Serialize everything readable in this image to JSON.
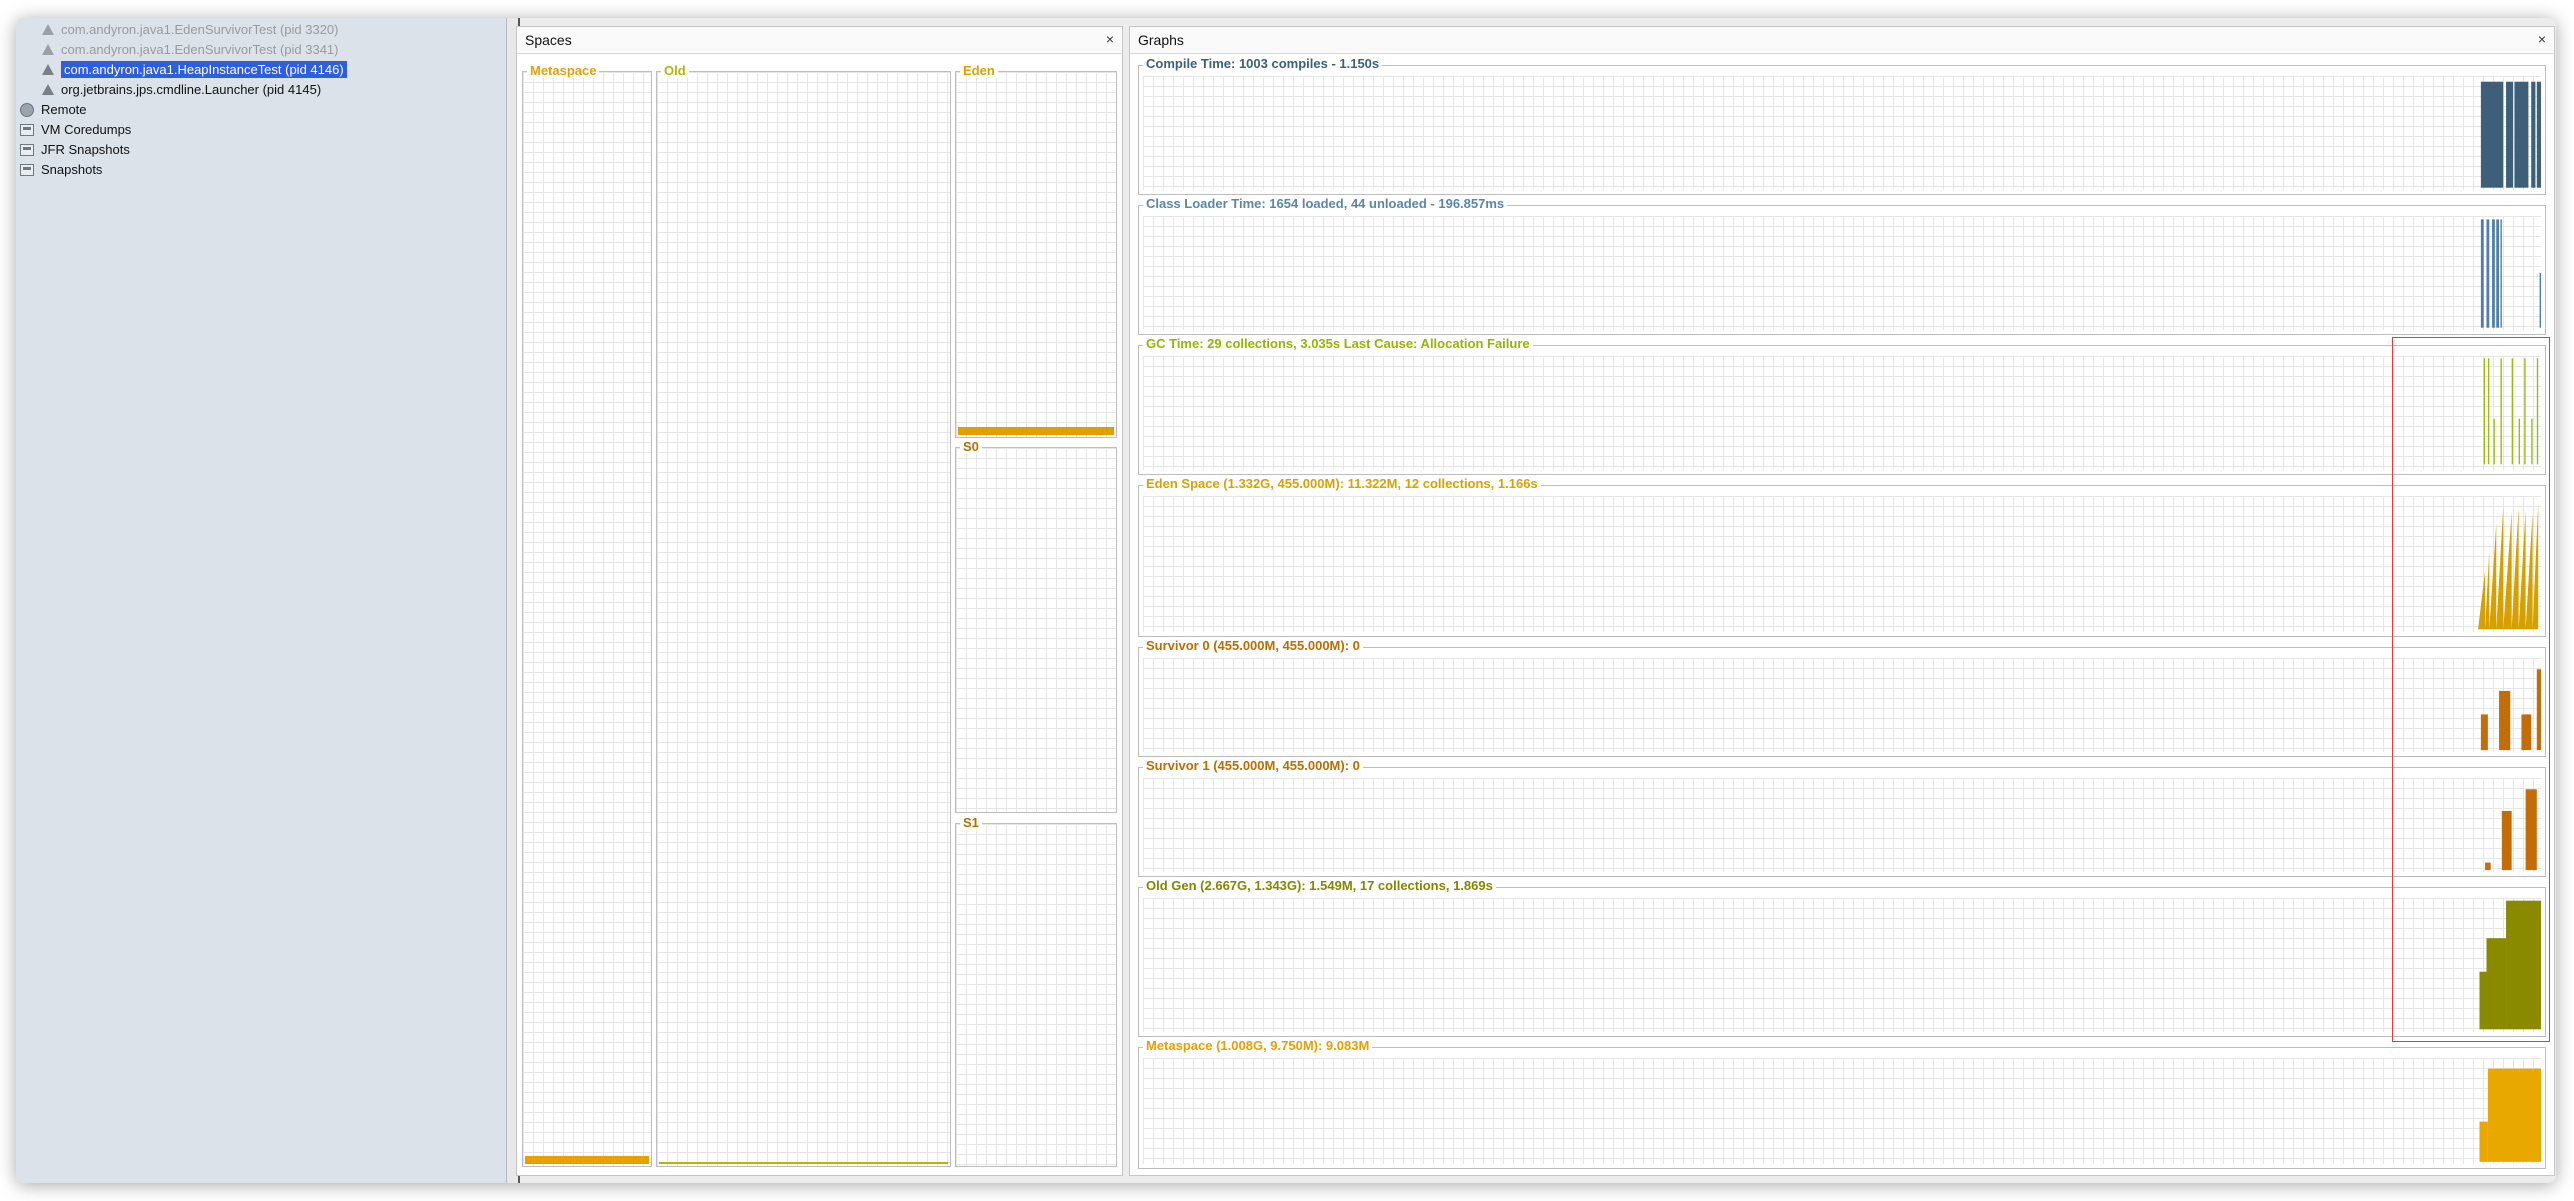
{
  "sidebar": {
    "items": [
      {
        "label": "com.andyron.java1.EdenSurvivorTest (pid 3320)",
        "state": "dim",
        "icon": "process-icon"
      },
      {
        "label": "com.andyron.java1.EdenSurvivorTest (pid 3341)",
        "state": "dim",
        "icon": "process-icon"
      },
      {
        "label": "com.andyron.java1.HeapInstanceTest (pid 4146)",
        "state": "selected",
        "icon": "process-icon"
      },
      {
        "label": "org.jetbrains.jps.cmdline.Launcher (pid 4145)",
        "state": "normal",
        "icon": "process-icon"
      },
      {
        "label": "Remote",
        "state": "normal",
        "icon": "globe-icon"
      },
      {
        "label": "VM Coredumps",
        "state": "normal",
        "icon": "coredump-icon"
      },
      {
        "label": "JFR Snapshots",
        "state": "normal",
        "icon": "jfr-icon"
      },
      {
        "label": "Snapshots",
        "state": "normal",
        "icon": "snapshot-icon"
      }
    ]
  },
  "spaces": {
    "title": "Spaces",
    "close": "×",
    "metaspace": {
      "label": "Metaspace",
      "color": "#e6a100",
      "fill": 0.015
    },
    "old": {
      "label": "Old",
      "color": "#b5b700",
      "fill": 0.003
    },
    "eden": {
      "label": "Eden",
      "color": "#e0a000",
      "fill": 0.025
    },
    "s0": {
      "label": "S0",
      "color": "#c87400",
      "fill": 0.0
    },
    "s1": {
      "label": "S1",
      "color": "#c87400",
      "fill": 0.0
    }
  },
  "graphs": {
    "title": "Graphs",
    "close": "×",
    "charts": [
      {
        "label": "Compile Time: 1003 compiles - 1.150s",
        "label_color": "#3d6078",
        "fill": "#3d6078"
      },
      {
        "label": "Class Loader Time: 1654 loaded, 44 unloaded - 196.857ms",
        "label_color": "#5a86a8",
        "fill": "#4f7fa8"
      },
      {
        "label": "GC Time: 29 collections, 3.035s  Last Cause: Allocation Failure",
        "label_color": "#97b400",
        "fill": "#9bbb12"
      },
      {
        "label": "Eden Space (1.332G, 455.000M): 11.322M, 12 collections, 1.166s",
        "label_color": "#d9a200",
        "fill": "#d6a000"
      },
      {
        "label": "Survivor 0 (455.000M, 455.000M): 0",
        "label_color": "#b96e00",
        "fill": "#c46d06"
      },
      {
        "label": "Survivor 1 (455.000M, 455.000M): 0",
        "label_color": "#b96e00",
        "fill": "#c46d06"
      },
      {
        "label": "Old Gen (2.667G, 1.343G): 1.549M, 17 collections, 1.869s",
        "label_color": "#858500",
        "fill": "#8a8a00"
      },
      {
        "label": "Metaspace (1.008G, 9.750M): 9.083M",
        "label_color": "#e6a100",
        "fill": "#e8a800"
      }
    ]
  }
}
